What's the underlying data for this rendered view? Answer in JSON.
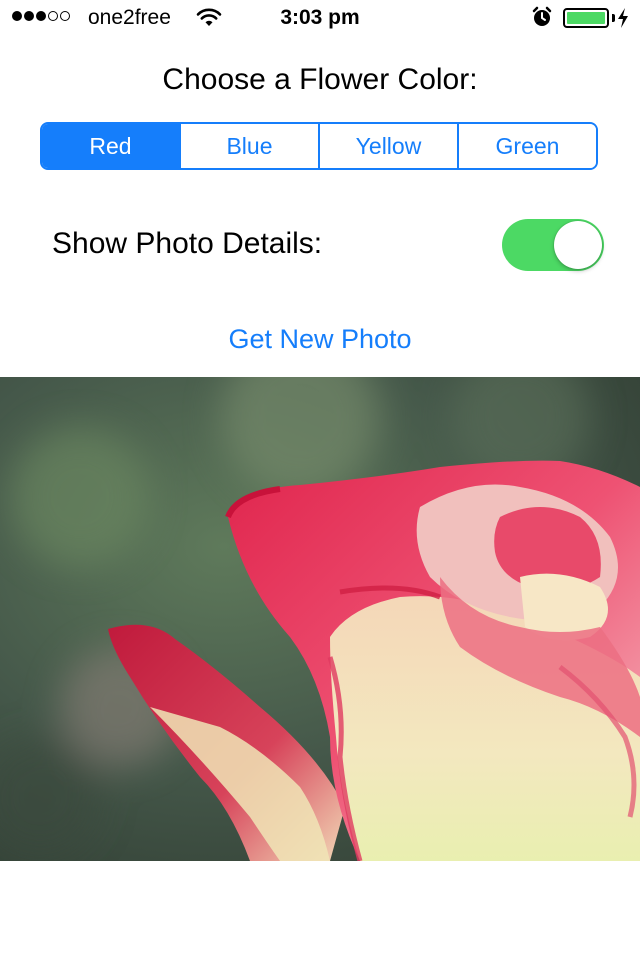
{
  "status_bar": {
    "signal_dots_filled": 3,
    "signal_dots_total": 5,
    "carrier": "one2free",
    "wifi_icon": "wifi-icon",
    "time": "3:03 pm",
    "alarm_icon": "alarm-clock-icon",
    "battery_icon": "battery-icon",
    "battery_level": 1.0,
    "battery_color": "#4cd964",
    "charging_icon": "charging-bolt-icon"
  },
  "main": {
    "heading": "Choose a Flower Color:",
    "color_picker": {
      "options": [
        "Red",
        "Blue",
        "Yellow",
        "Green"
      ],
      "selected": "Red",
      "accent_color": "#157efb"
    },
    "details_label": "Show Photo Details:",
    "details_toggle": {
      "on": true,
      "on_color": "#4cd964"
    },
    "new_photo_button": "Get New Photo",
    "photo": {
      "subject": "red-and-cream rose"
    }
  }
}
